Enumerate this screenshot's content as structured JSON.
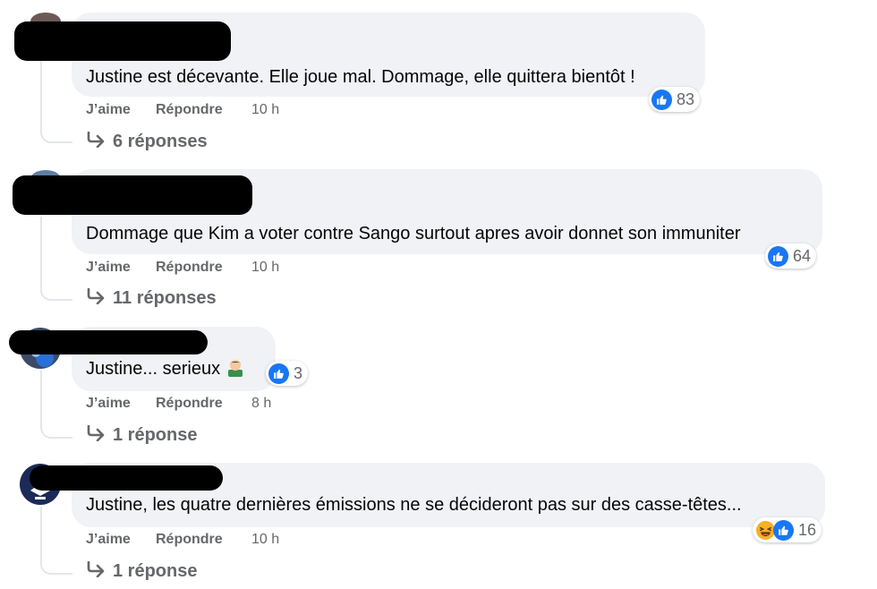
{
  "comments": [
    {
      "text": "Justine est décevante. Elle joue mal. Dommage, elle quittera bientôt !",
      "like": "J’aime",
      "reply": "Répondre",
      "time": "10 h",
      "reaction_count": "83",
      "replies": "6 réponses",
      "reaction_icons": [
        "like-icon"
      ]
    },
    {
      "text": "Dommage que Kim a voter contre Sango surtout apres avoir donnet son immuniter",
      "like": "J’aime",
      "reply": "Répondre",
      "time": "10 h",
      "reaction_count": "64",
      "replies": "11 réponses",
      "reaction_icons": [
        "like-icon"
      ]
    },
    {
      "text": "Justine... serieux",
      "like": "J’aime",
      "reply": "Répondre",
      "time": "8 h",
      "reaction_count": "3",
      "replies": "1 réponse",
      "reaction_icons": [
        "like-icon"
      ],
      "emoji": "man-technologist-emoji"
    },
    {
      "text": "Justine, les quatre dernières émissions ne se décideront pas sur des casse-têtes...",
      "like": "J’aime",
      "reply": "Répondre",
      "time": "10 h",
      "reaction_count": "16",
      "replies": "1 réponse",
      "reaction_icons": [
        "haha-icon",
        "like-icon"
      ]
    }
  ],
  "colors": {
    "like": "#1877f2",
    "bubble": "#f0f2f5",
    "muted": "#65676b",
    "redaction": "#000000"
  }
}
